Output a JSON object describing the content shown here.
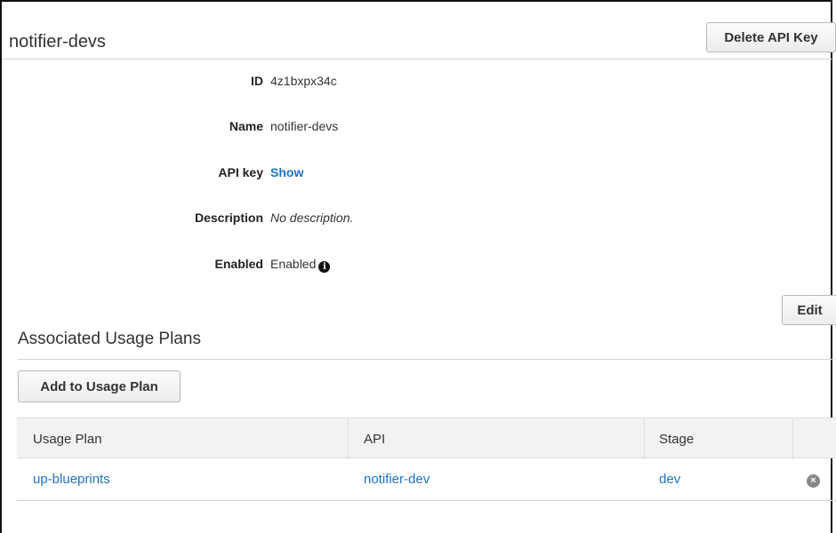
{
  "header": {
    "title": "notifier-devs",
    "delete_label": "Delete API Key"
  },
  "details": [
    {
      "label": "ID",
      "value": "4z1bxpx34c"
    },
    {
      "label": "Name",
      "value": "notifier-devs"
    },
    {
      "label": "API key",
      "value": "Show"
    },
    {
      "label": "Description",
      "value": "No description."
    },
    {
      "label": "Enabled",
      "value": "Enabled"
    }
  ],
  "edit_label": "Edit",
  "usage_plans": {
    "title": "Associated Usage Plans",
    "add_label": "Add to Usage Plan",
    "columns": [
      "Usage Plan",
      "API",
      "Stage"
    ],
    "rows": [
      {
        "usage_plan": "up-blueprints",
        "api": "notifier-dev",
        "stage": "dev"
      }
    ]
  },
  "colors": {
    "link": "#1f73c7",
    "header_bg": "#f2f2f2",
    "rule": "#d5d5d5"
  },
  "icons": {
    "enabled_info": "info-circle-icon",
    "remove_row": "remove-circle-icon"
  }
}
